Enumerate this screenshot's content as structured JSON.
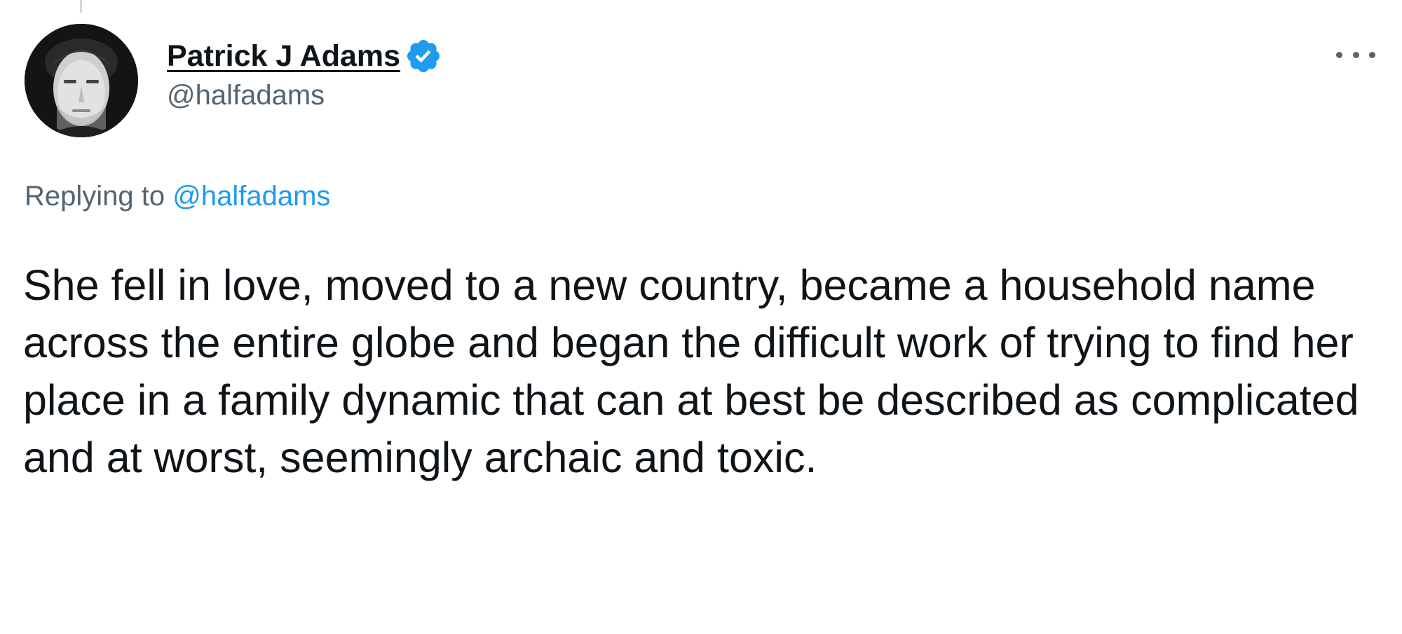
{
  "tweet": {
    "author": {
      "display_name": "Patrick J Adams",
      "handle": "@halfadams",
      "verified": true,
      "verified_icon": "verified-badge-icon",
      "verified_color": "#1d9bf0"
    },
    "replying_to": {
      "prefix": "Replying to",
      "mention": "@halfadams"
    },
    "text": "She fell in love, moved to a new country, became a household name across the entire globe and began the difficult work of trying to find her place in a family dynamic that can at best be described as complicated and at worst, seemingly archaic and toxic.",
    "more_icon": "more-options-icon"
  },
  "colors": {
    "text_primary": "#0f1419",
    "text_secondary": "#536471",
    "accent": "#1d9bf0"
  }
}
